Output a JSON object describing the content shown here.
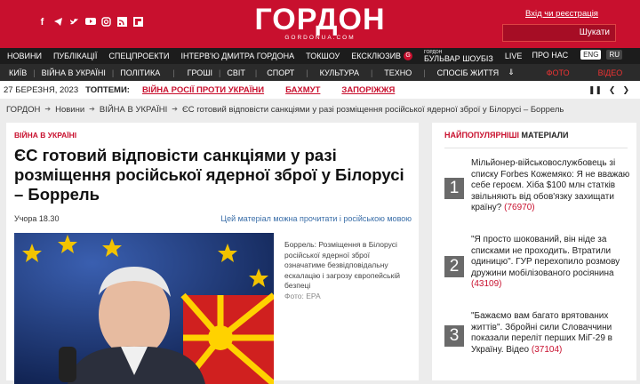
{
  "header": {
    "logo": "ГОРДОН",
    "logo_sub": "GORDONUA.COM",
    "login": "Вхід чи реєстрація",
    "search_button": "Шукати",
    "social_icons": [
      "facebook-icon",
      "telegram-icon",
      "twitter-icon",
      "youtube-icon",
      "instagram-icon",
      "rss-icon",
      "flipboard-icon"
    ]
  },
  "nav_primary": {
    "items": [
      "НОВИНИ",
      "ПУБЛІКАЦІЇ",
      "СПЕЦПРОЕКТИ",
      "ІНТЕРВ'Ю ДМИТРА ГОРДОНА",
      "ТОКШОУ",
      "ЕКСКЛЮЗИВ",
      "БУЛЬВАР ШОУБІЗ",
      "LIVE"
    ],
    "exclusive_badge": "G",
    "bulvar_prefix": "ГОРДОН",
    "about": "ПРО НАС",
    "lang_en": "ENG",
    "lang_ru": "RU"
  },
  "nav_secondary": {
    "items": [
      "КИЇВ",
      "ВІЙНА В УКРАЇНІ",
      "ПОЛІТИКА",
      "ГРОШІ",
      "СВІТ",
      "СПОРТ",
      "КУЛЬТУРА",
      "ТЕХНО",
      "СПОСІБ ЖИТТЯ"
    ],
    "more": "⇓",
    "photo": "ФОТО",
    "video": "ВІДЕО"
  },
  "topbar": {
    "date": "27 БЕРЕЗНЯ, 2023",
    "topics_label": "ТОПТЕМИ:",
    "topics": [
      "ВІЙНА РОСІЇ ПРОТИ УКРАЇНИ",
      "БАХМУТ",
      "ЗАПОРІЖЖЯ"
    ]
  },
  "breadcrumb": [
    "ГОРДОН",
    "Новини",
    "ВІЙНА В УКРАЇНІ",
    "ЄС готовий відповісти санкціями у разі розміщення російської ядерної зброї у Білорусі – Боррель"
  ],
  "article": {
    "rubric": "ВІЙНА В УКРАЇНІ",
    "title": "ЄС готовий відповісти санкціями у разі розміщення російської ядерної зброї у Білорусі – Боррель",
    "time": "Учора 18.30",
    "alt_lang": "Цей матеріал можна прочитати і російською мовою",
    "caption": "Боррель: Розміщення в Білорусі російської ядерної зброї означатиме безвідповідальну ескалацію і загрозу європейській безпеці",
    "photo_credit": "Фото: EPA"
  },
  "sidebar": {
    "heading_red": "НАЙПОПУЛЯРНІШІ",
    "heading_rest": "МАТЕРІАЛИ",
    "items": [
      {
        "num": "1",
        "text": "Мільйонер-військовослужбовець зі списку Forbes Кожемяко: Я не вважаю себе героєм. Хіба $100 млн статків звільняють від обов'язку захищати країну?",
        "count": "(76970)"
      },
      {
        "num": "2",
        "text": "\"Я просто шокований, він ніде за списками не проходить. Втратили одиницю\". ГУР перехопило розмову дружини мобілізованого росіянина",
        "count": "(43109)"
      },
      {
        "num": "3",
        "text": "\"Бажаємо вам багато врятованих життів\". Збройні сили Словаччини показали переліт перших МіГ-29 в Україну. Відео",
        "count": "(37104)"
      }
    ]
  },
  "colors": {
    "brand": "#c8102e",
    "nav": "#1c1c1c",
    "link": "#3a6ea8"
  }
}
